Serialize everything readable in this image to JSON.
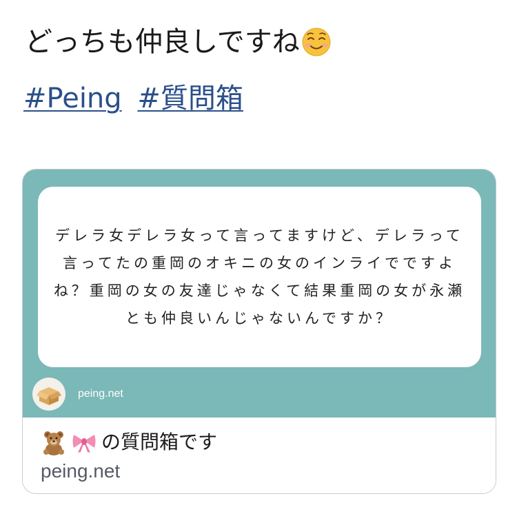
{
  "tweet": {
    "text": "どっちも仲良しですね",
    "emoji": "smiling-face-icon"
  },
  "hashtags": [
    "#Peing",
    "#質問箱"
  ],
  "card": {
    "question": "デレラ女デレラ女って言ってますけど、デレラって言ってたの重岡のオキニの女のインライでですよね？重岡の女の友達じゃなくて結果重岡の女が永瀬とも仲良いんじゃないんですか？",
    "brand_name": "peing.net",
    "title_suffix": "の質問箱です",
    "title_emojis": [
      "teddy-bear-icon",
      "ribbon-icon"
    ],
    "domain": "peing.net",
    "colors": {
      "background": "#7bb8b8",
      "box": "#ffffff"
    }
  }
}
